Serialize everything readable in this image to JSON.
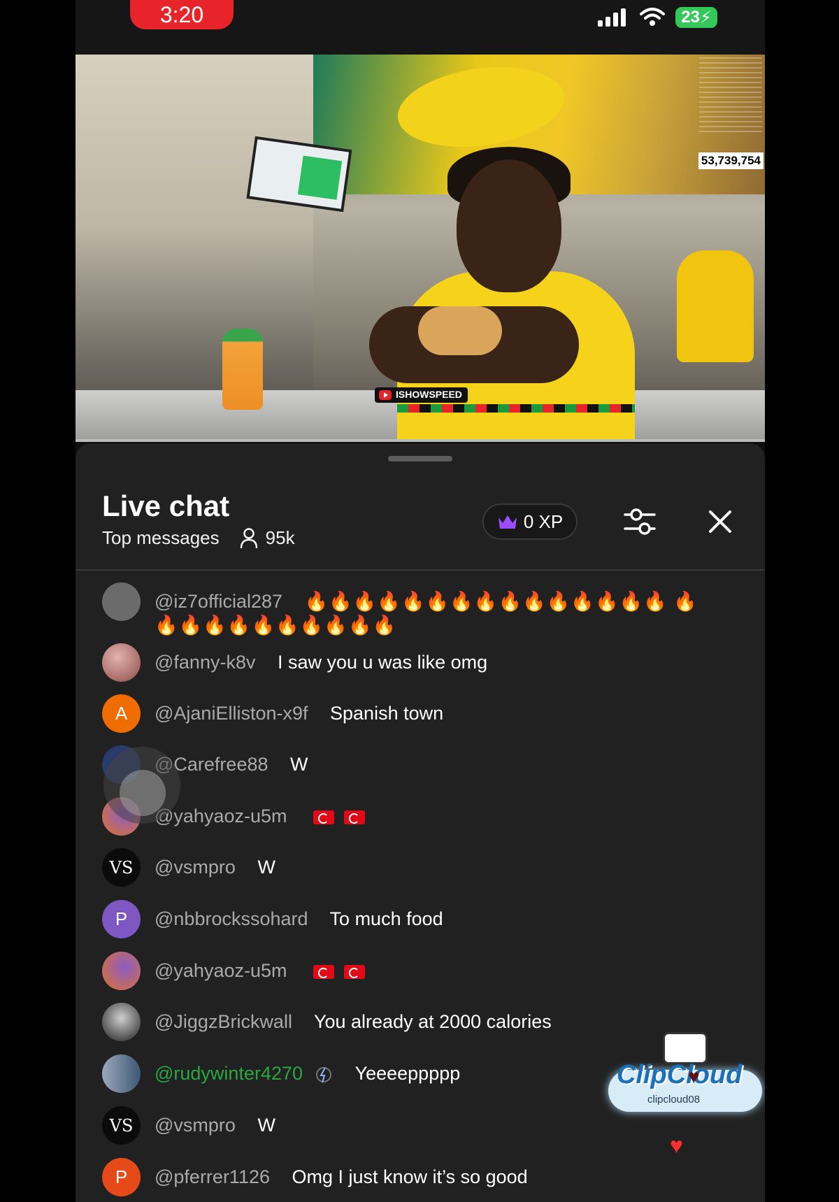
{
  "status_bar": {
    "time": "3:20",
    "battery": "23"
  },
  "video": {
    "view_count": "53,739,754",
    "channel_tag": "ISHOWSPEED"
  },
  "chat": {
    "title": "Live chat",
    "mode": "Top messages",
    "viewers": "95k",
    "xp": "0 XP",
    "icons": [
      "crown-icon",
      "person-icon",
      "filter-icon",
      "close-icon"
    ],
    "messages": [
      {
        "author": "@iz7official287",
        "text": "🔥🔥🔥🔥🔥🔥🔥🔥🔥🔥🔥🔥🔥🔥🔥 🔥🔥🔥🔥🔥🔥🔥🔥🔥🔥🔥",
        "avatar_letter": "",
        "avatar_color": "#6b6b6b"
      },
      {
        "author": "@fanny-k8v",
        "text": "I saw you u was like omg",
        "avatar_letter": "",
        "avatar_color": "#c98a86"
      },
      {
        "author": "@AjaniElliston-x9f",
        "text": "Spanish town",
        "avatar_letter": "A",
        "avatar_color": "#ef6c00"
      },
      {
        "author": "@Carefree88",
        "text": "W",
        "avatar_letter": "",
        "avatar_color": "#2a3b6a"
      },
      {
        "author": "@yahyaoz-u5m",
        "text": "",
        "avatar_letter": "",
        "avatar_color": "#7b4aa8"
      },
      {
        "author": "@vsmpro",
        "text": "W",
        "avatar_letter": "VS",
        "avatar_color": "#0b0b0b"
      },
      {
        "author": "@nbbrockssohard",
        "text": "To much food",
        "avatar_letter": "P",
        "avatar_color": "#7e57c2"
      },
      {
        "author": "@yahyaoz-u5m",
        "text": "",
        "avatar_letter": "",
        "avatar_color": "#7b4aa8"
      },
      {
        "author": "@JiggzBrickwall",
        "text": "You already at 2000 calories",
        "avatar_letter": "",
        "avatar_color": "#3a3a3a"
      },
      {
        "author": "@rudywinter4270",
        "text": "Yeeeeppppp",
        "avatar_letter": "",
        "avatar_color": "#5a6f88"
      },
      {
        "author": "@vsmpro",
        "text": "W",
        "avatar_letter": "VS",
        "avatar_color": "#0b0b0b"
      },
      {
        "author": "@pferrer1126",
        "text": "Omg I just know it’s so good",
        "avatar_letter": "P",
        "avatar_color": "#e64a19"
      }
    ]
  },
  "watermark": {
    "title": "ClipCloud",
    "handle": "clipcloud08"
  }
}
